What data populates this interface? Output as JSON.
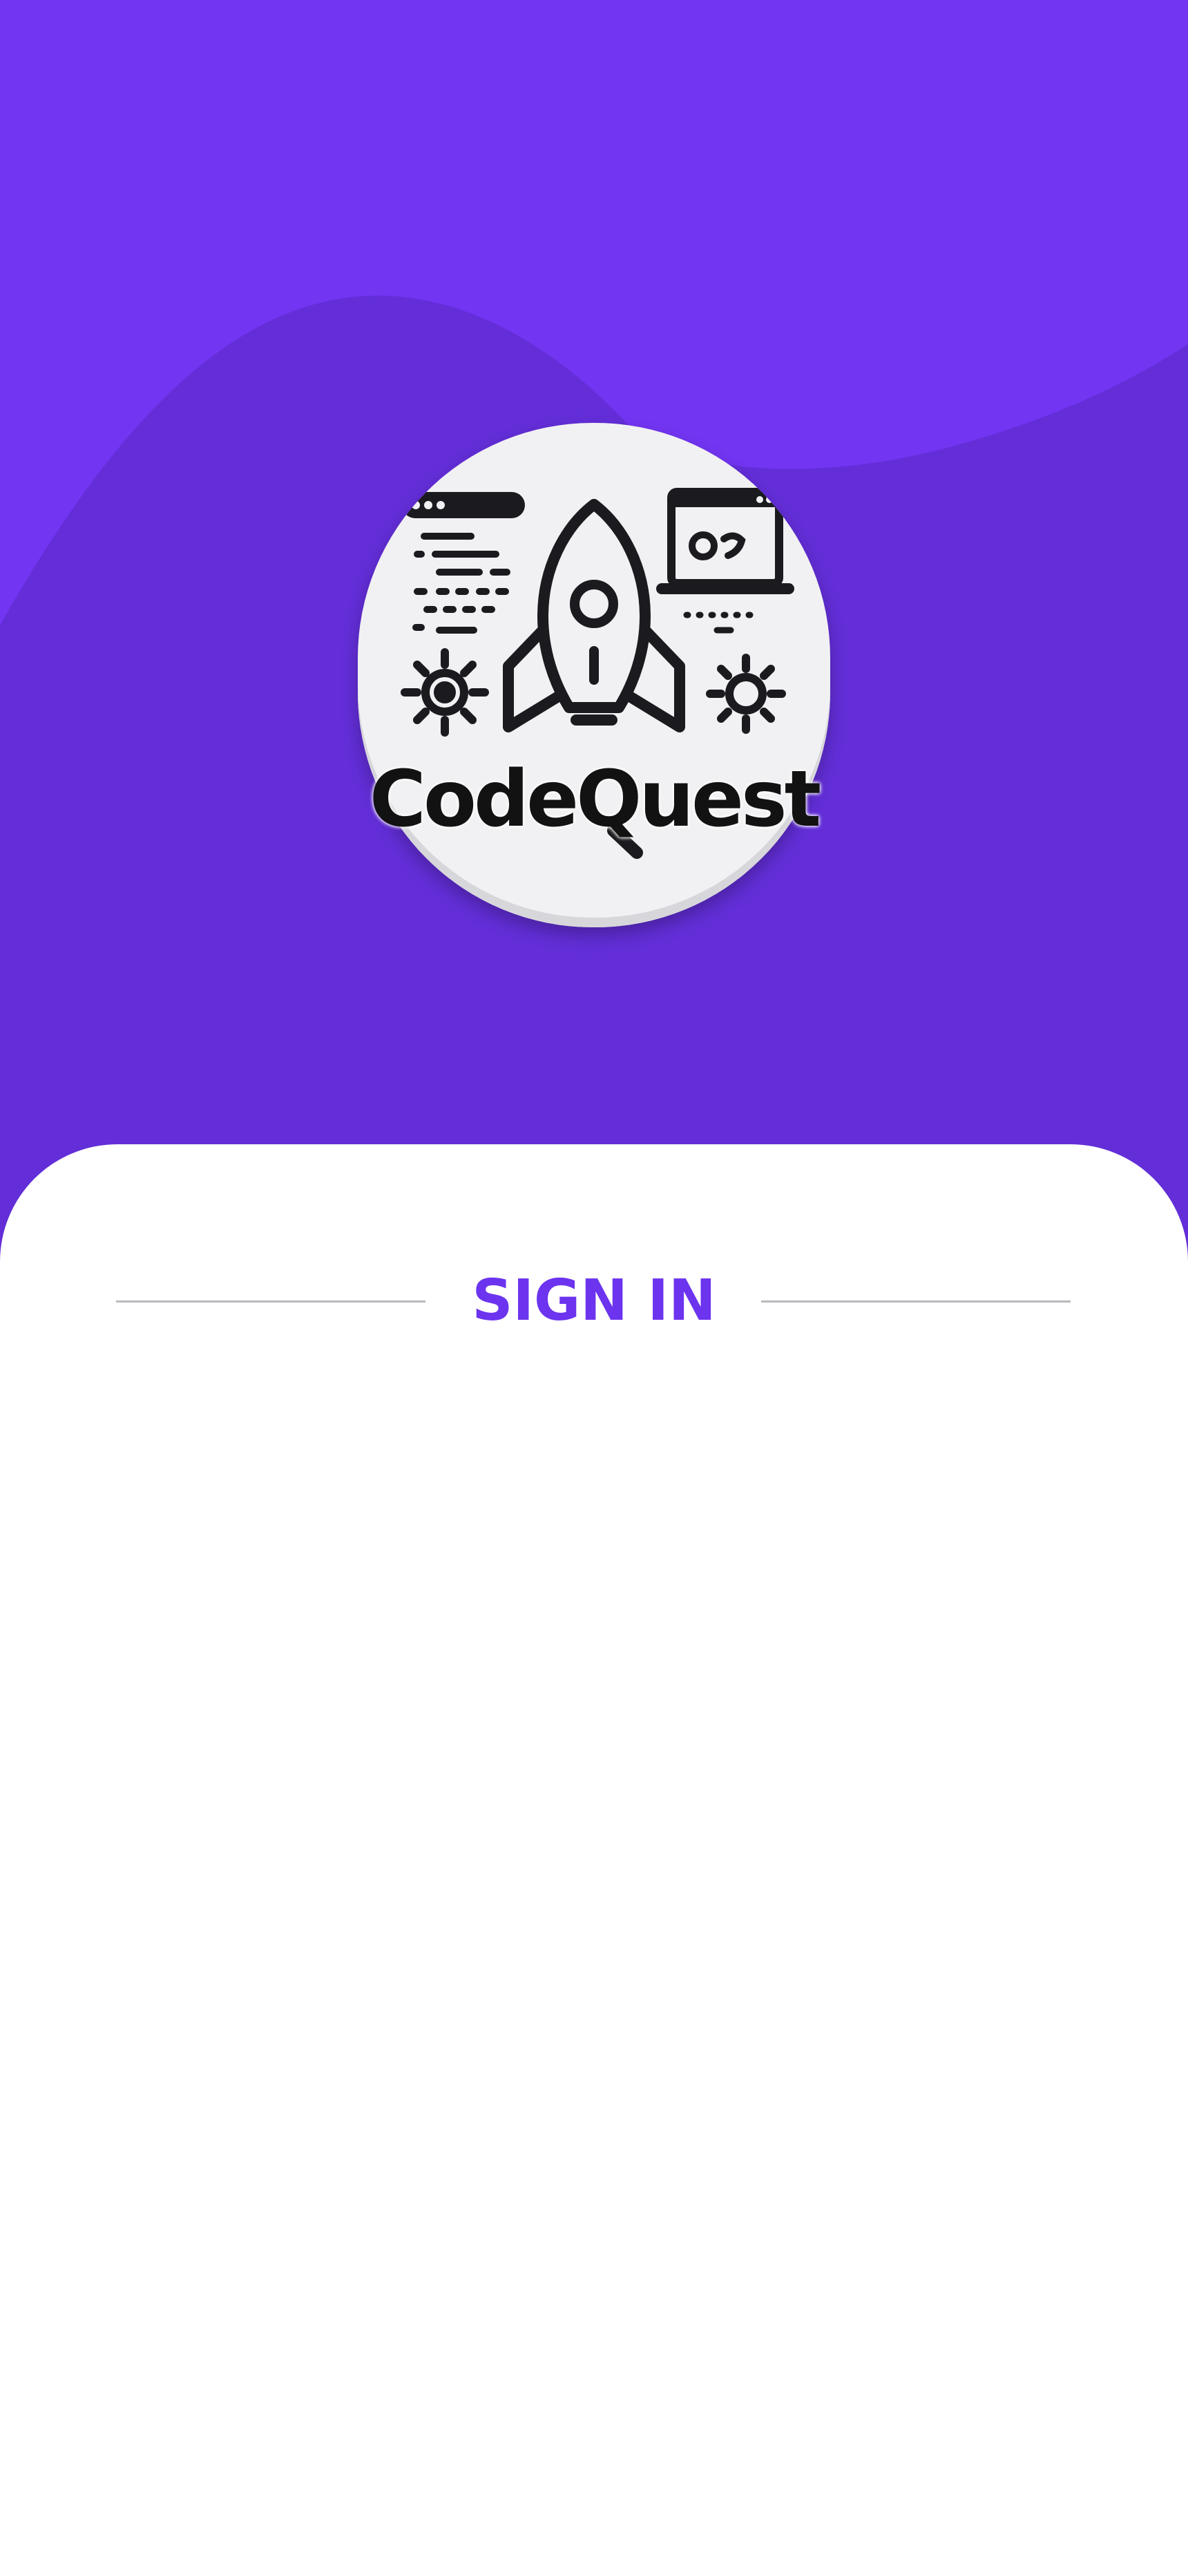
{
  "app": {
    "brand_name": "CodeQuest",
    "logo_icon": "rocket-code-logo"
  },
  "signin": {
    "title": "SIGN IN"
  },
  "colors": {
    "hero_purple": "#7235f2",
    "hero_purple_dark": "#632ed8",
    "accent": "#6c34ee",
    "panel": "#ffffff",
    "divider": "#b9b9bf"
  }
}
